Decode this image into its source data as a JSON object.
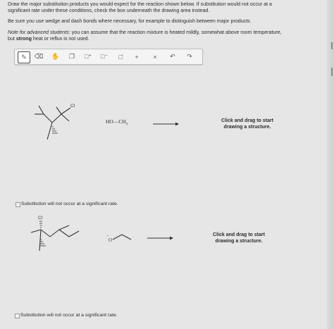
{
  "instructions": {
    "line1": "Draw the major substitution products you would expect for the reaction shown below. If substitution would not occur at a",
    "line2": "significant rate under these conditions, check the box underneath the drawing area instead.",
    "line3": "Be sure you use wedge and dash bonds where necessary, for example to distinguish between major products.",
    "note_label": "Note for advanced students:",
    "note_text": " you can assume that the reaction mixture is heated mildly, somewhat above room temperature,",
    "note_line2_pre": "but ",
    "note_strong": "strong",
    "note_line2_post": " heat or reflux is not used."
  },
  "toolbar": {
    "tools": [
      {
        "icon": "pencil-icon",
        "glyph": "✎",
        "active": true
      },
      {
        "icon": "eraser-icon",
        "glyph": "⌫",
        "active": false
      },
      {
        "icon": "hand-icon",
        "glyph": "✋",
        "active": false
      },
      {
        "icon": "copy-icon",
        "glyph": "❐",
        "active": false
      },
      {
        "icon": "plus-charge-icon",
        "glyph": "□⁺",
        "active": false
      },
      {
        "icon": "minus-charge-icon",
        "glyph": "□⁻",
        "active": false
      },
      {
        "icon": "lone-pair-icon",
        "glyph": "□̈",
        "active": false
      },
      {
        "icon": "plus-icon",
        "glyph": "+",
        "active": false
      },
      {
        "icon": "close-icon",
        "glyph": "×",
        "active": false
      },
      {
        "icon": "undo-icon",
        "glyph": "↶",
        "active": false
      },
      {
        "icon": "redo-icon",
        "glyph": "↷",
        "active": false
      }
    ]
  },
  "reaction1": {
    "substituent": "Cl",
    "reagent": "HO—CH",
    "reagent_sub": "3",
    "prompt_line1": "Click and drag to start",
    "prompt_line2": "drawing a structure.",
    "checkbox_label": "Substitution will not occur at a significant rate."
  },
  "reaction2": {
    "substituent": "Cl",
    "nucleophile_charge": "−",
    "nucleophile_atom": "O",
    "prompt_line1": "Click and drag to start",
    "prompt_line2": "drawing a structure.",
    "checkbox_label": "Substitution will not occur at a significant rate."
  }
}
